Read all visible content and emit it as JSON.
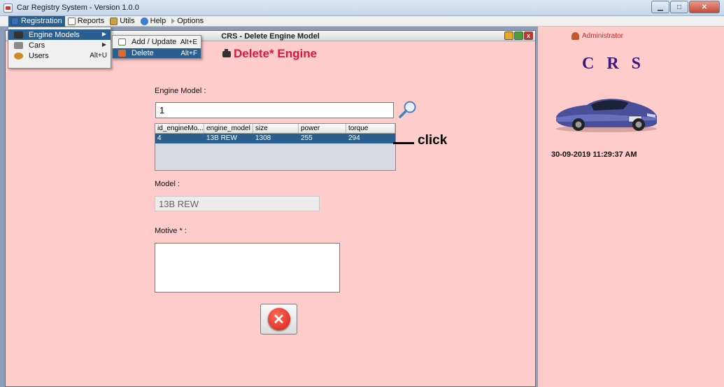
{
  "window": {
    "title": "Car Registry System  -  Version 1.0.0"
  },
  "menubar": {
    "items": [
      {
        "label": "Registration",
        "icon": "registration-icon"
      },
      {
        "label": "Reports",
        "icon": "reports-icon"
      },
      {
        "label": "Utils",
        "icon": "utils-icon"
      },
      {
        "label": "Help",
        "icon": "help-icon"
      },
      {
        "label": "Options",
        "icon": "options-icon"
      }
    ]
  },
  "registration_menu": {
    "items": [
      {
        "label": "Engine Models",
        "icon": "engine-icon",
        "has_submenu": true
      },
      {
        "label": "Cars",
        "icon": "car-icon",
        "has_submenu": true
      },
      {
        "label": "Users",
        "icon": "users-icon",
        "accelerator": "Alt+U"
      }
    ]
  },
  "engine_submenu": {
    "items": [
      {
        "label": "Add / Update",
        "accelerator": "Alt+E"
      },
      {
        "label": "Delete",
        "accelerator": "Alt+F"
      }
    ]
  },
  "frame": {
    "title": "CRS - Delete Engine Model",
    "heading": "Delete* Engine",
    "engine_model_label": "Engine Model :",
    "search_value": "1",
    "model_label": "Model :",
    "model_value": "13B REW",
    "motive_label": "Motive * :",
    "motive_value": ""
  },
  "table": {
    "columns": [
      "id_engineMo...",
      "engine_model",
      "size",
      "power",
      "torque"
    ],
    "rows": [
      [
        "4",
        "13B REW",
        "1308",
        "255",
        "294"
      ]
    ]
  },
  "annotation": {
    "text": "click"
  },
  "sidebar": {
    "user": "Administrator",
    "logo": "C R S",
    "datetime": "30-09-2019 11:29:37 AM"
  },
  "colors": {
    "frame_bg": "#ffcccc",
    "heading": "#e8143c",
    "selection": "#2b5f8f",
    "logo": "#3a1a7a"
  }
}
